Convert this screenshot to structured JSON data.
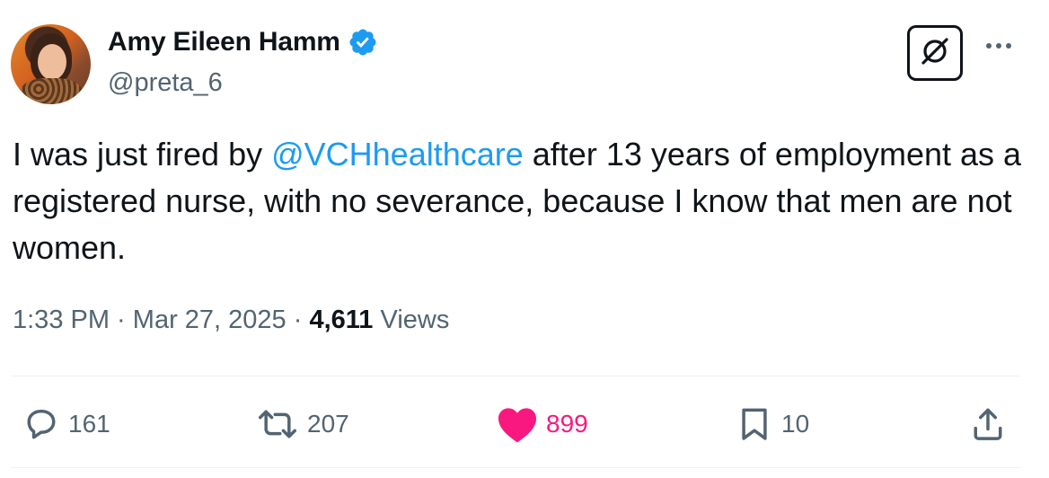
{
  "author": {
    "display_name": "Amy Eileen Hamm",
    "handle": "@preta_6",
    "verified": true
  },
  "tweet": {
    "text_before": "I was just fired by ",
    "mention": "@VCHhealthcare",
    "text_after": " after 13 years of employment as a registered nurse, with no severance, because I know that men are not women."
  },
  "meta": {
    "time": "1:33 PM",
    "sep1": " · ",
    "date": "Mar 27, 2025",
    "sep2": " · ",
    "views_count": "4,611",
    "views_label": " Views"
  },
  "actions": {
    "replies": "161",
    "reposts": "207",
    "likes": "899",
    "bookmarks": "10"
  },
  "colors": {
    "accent": "#1d9bf0",
    "like": "#f91880",
    "muted": "#536471",
    "text": "#0f1419"
  },
  "icons": {
    "verified": "verified-badge-icon",
    "grok": "grok-icon",
    "more": "more-dots-icon",
    "reply": "reply-bubble-icon",
    "repost": "repost-arrows-icon",
    "like": "heart-icon",
    "bookmark": "bookmark-icon",
    "share": "share-icon"
  }
}
